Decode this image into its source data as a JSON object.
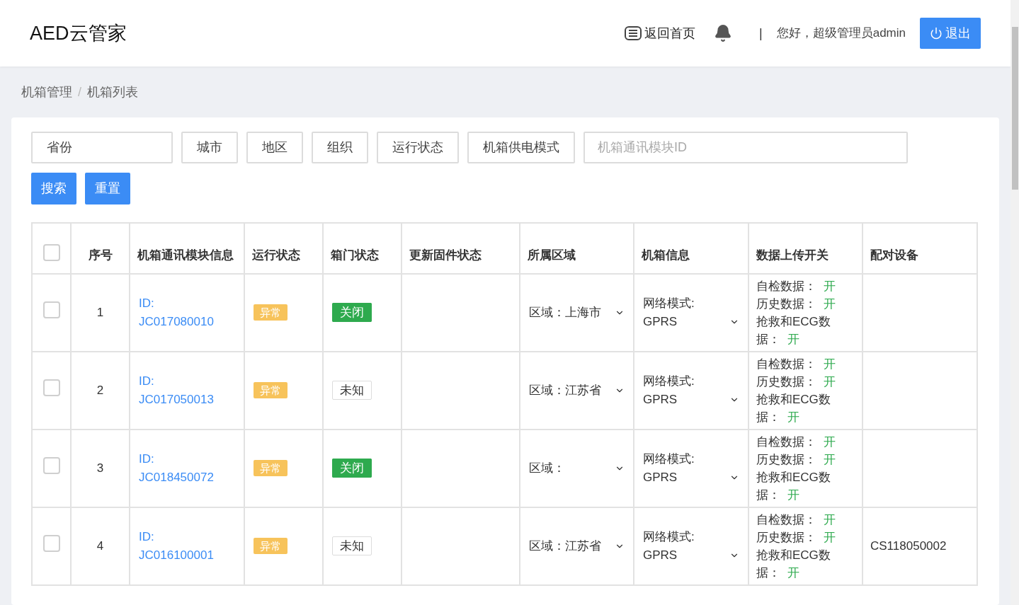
{
  "header": {
    "logo": "AED云管家",
    "home_link": "返回首页",
    "greeting_separator": "|",
    "greeting": "您好，超级管理员admin",
    "logout": "退出"
  },
  "breadcrumb": [
    "机箱管理",
    "机箱列表"
  ],
  "breadcrumb_separator": "/",
  "filters": [
    {
      "kind": "select",
      "label": "省份"
    },
    {
      "kind": "select",
      "label": "城市"
    },
    {
      "kind": "select",
      "label": "地区"
    },
    {
      "kind": "select",
      "label": "组织"
    },
    {
      "kind": "select",
      "label": "运行状态"
    },
    {
      "kind": "select",
      "label": "机箱供电模式"
    },
    {
      "kind": "input",
      "placeholder": "机箱通讯模块ID"
    }
  ],
  "actions": [
    "搜索",
    "重置"
  ],
  "table": {
    "header_checked": false,
    "columns": [
      "序号",
      "机箱通讯模块信息",
      "运行状态",
      "箱门状态",
      "更新固件状态",
      "所属区域",
      "机箱信息",
      "数据上传开关",
      "配对设备"
    ],
    "rows": [
      {
        "checked": false,
        "index": "1",
        "id_label": "ID:",
        "id": "JC017080010",
        "run_status": "异常",
        "door": {
          "kind": "closed",
          "text": "关闭"
        },
        "region": "区域：上海市",
        "network_label": "网络模式:",
        "network": "GPRS",
        "uploads": [
          {
            "label": "自检数据：",
            "value": "开",
            "on": true
          },
          {
            "label": "历史数据：",
            "value": "开",
            "on": true
          },
          {
            "label": "抢救和ECG数据：",
            "value": "开",
            "on": true
          }
        ],
        "paired": ""
      },
      {
        "checked": false,
        "index": "2",
        "id_label": "ID:",
        "id": "JC017050013",
        "run_status": "异常",
        "door": {
          "kind": "unknown",
          "text": "未知"
        },
        "region": "区域：江苏省",
        "network_label": "网络模式:",
        "network": "GPRS",
        "uploads": [
          {
            "label": "自检数据：",
            "value": "开",
            "on": true
          },
          {
            "label": "历史数据：",
            "value": "开",
            "on": true
          },
          {
            "label": "抢救和ECG数据：",
            "value": "开",
            "on": true
          }
        ],
        "paired": ""
      },
      {
        "checked": false,
        "index": "3",
        "id_label": "ID:",
        "id": "JC018450072",
        "run_status": "异常",
        "door": {
          "kind": "closed",
          "text": "关闭"
        },
        "region": "区域：",
        "network_label": "网络模式:",
        "network": "GPRS",
        "uploads": [
          {
            "label": "自检数据：",
            "value": "开",
            "on": true
          },
          {
            "label": "历史数据：",
            "value": "开",
            "on": true
          },
          {
            "label": "抢救和ECG数据：",
            "value": "开",
            "on": true
          }
        ],
        "paired": ""
      },
      {
        "checked": false,
        "index": "4",
        "id_label": "ID:",
        "id": "JC016100001",
        "run_status": "异常",
        "door": {
          "kind": "unknown",
          "text": "未知"
        },
        "region": "区域：江苏省",
        "network_label": "网络模式:",
        "network": "GPRS",
        "uploads": [
          {
            "label": "自检数据：",
            "value": "开",
            "on": true
          },
          {
            "label": "历史数据：",
            "value": "开",
            "on": true
          },
          {
            "label": "抢救和ECG数据：",
            "value": "开",
            "on": true
          }
        ],
        "paired": "CS118050002"
      }
    ]
  }
}
